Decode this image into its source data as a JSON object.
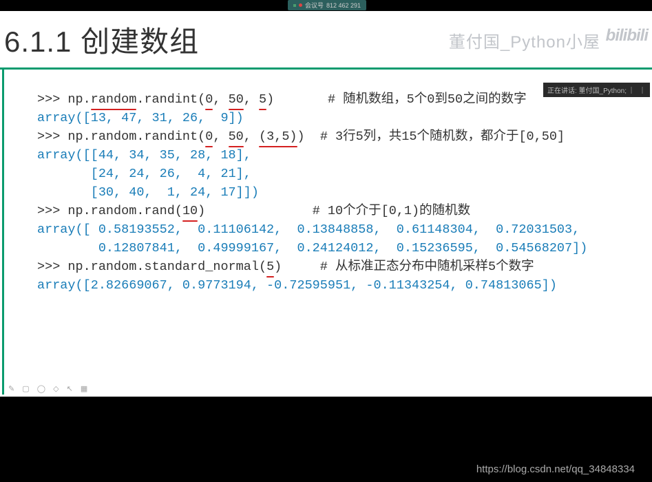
{
  "meeting": {
    "label": "会议号",
    "number": "812 462 291"
  },
  "slide": {
    "title": "6.1.1  创建数组",
    "watermark": "董付国_Python小屋",
    "logo": "bilibili"
  },
  "overlay": {
    "status": "正在讲话: 董付国_Python;"
  },
  "code": {
    "line1_prompt": ">>> np.",
    "line1_rand": "random",
    "line1_mid": ".randint(",
    "line1_arg1": "0",
    "line1_sep1": ", ",
    "line1_arg2": "50",
    "line1_sep2": ", ",
    "line1_arg3": "5",
    "line1_close": ")       ",
    "line1_comment": "# 随机数组，5个0到50之间的数字",
    "line2_out": "array([13, 47, 31, 26,  9])",
    "line3_prompt": ">>> np.random.randint(",
    "line3_arg1": "0",
    "line3_sep1": ", ",
    "line3_arg2": "50",
    "line3_sep2": ", ",
    "line3_arg3": "(3,5)",
    "line3_close": ")  ",
    "line3_comment": "# 3行5列，共15个随机数，都介于[0,50]",
    "line4_out": "array([[44, 34, 35, 28, 18],",
    "line5_out": "       [24, 24, 26,  4, 21],",
    "line6_out": "       [30, 40,  1, 24, 17]])",
    "line7_prompt": ">>> np.random.rand(",
    "line7_arg": "10",
    "line7_close": ")              ",
    "line7_comment": "# 10个介于[0,1)的随机数",
    "line8_out": "array([ 0.58193552,  0.11106142,  0.13848858,  0.61148304,  0.72031503,",
    "line9_out": "        0.12807841,  0.49999167,  0.24124012,  0.15236595,  0.54568207])",
    "line10_prompt": ">>> np.random.standard_normal(",
    "line10_arg": "5",
    "line10_close": ")     ",
    "line10_comment": "# 从标准正态分布中随机采样5个数字",
    "line11_out": "array([2.82669067, 0.9773194, -0.72595951, -0.11343254, 0.74813065])"
  },
  "footer": {
    "url": "https://blog.csdn.net/qq_34848334"
  },
  "toolbar": "✎ ▢ ◯ ◇ ↖ ▦"
}
